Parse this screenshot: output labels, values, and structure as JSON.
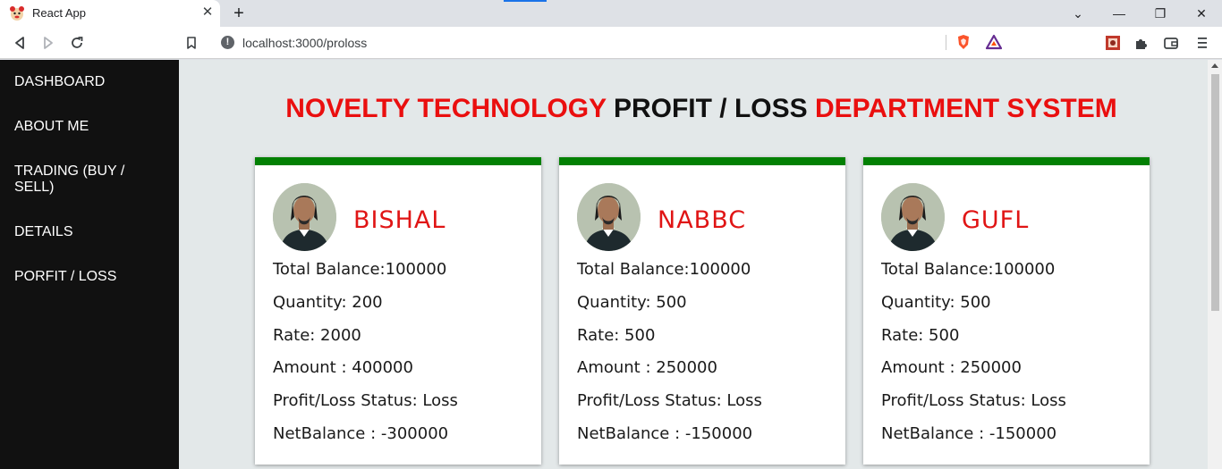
{
  "browser": {
    "tab_title": "React App",
    "tab_close": "✕",
    "new_tab": "+",
    "url": "localhost:3000/proloss",
    "window_controls": {
      "dropdown": "⌄",
      "minimize": "—",
      "restore": "❐",
      "close": "✕"
    },
    "icons": [
      "back-icon",
      "forward-icon",
      "reload-icon",
      "bookmark-icon",
      "site-info-icon",
      "brave-shields-icon",
      "brave-rewards-icon",
      "extension-icon",
      "puzzle-icon",
      "wallet-icon",
      "menu-icon"
    ]
  },
  "sidebar": {
    "items": [
      {
        "label": "DASHBOARD"
      },
      {
        "label": "ABOUT ME"
      },
      {
        "label": "TRADING (BUY / SELL)"
      },
      {
        "label": "DETAILS"
      },
      {
        "label": "PORFIT / LOSS"
      }
    ]
  },
  "heading": {
    "part1": "NOVELTY TECHNOLOGY",
    "part2": "PROFIT / LOSS",
    "part3": "DEPARTMENT SYSTEM"
  },
  "cards": [
    {
      "name": "BISHAL",
      "total_balance": "Total Balance:100000",
      "quantity": "Quantity: 200",
      "rate": "Rate: 2000",
      "amount": "Amount : 400000",
      "status": "Profit/Loss Status: Loss",
      "net_balance": "NetBalance : -300000"
    },
    {
      "name": "NABBC",
      "total_balance": "Total Balance:100000",
      "quantity": "Quantity: 500",
      "rate": "Rate: 500",
      "amount": "Amount : 250000",
      "status": "Profit/Loss Status: Loss",
      "net_balance": "NetBalance : -150000"
    },
    {
      "name": "GUFL",
      "total_balance": "Total Balance:100000",
      "quantity": "Quantity: 500",
      "rate": "Rate: 500",
      "amount": "Amount : 250000",
      "status": "Profit/Loss Status: Loss",
      "net_balance": "NetBalance : -150000"
    }
  ],
  "colors": {
    "accent_red": "#ea0f0f",
    "card_top": "#028003",
    "sidebar_bg": "#111111",
    "main_bg": "#e3e8e9"
  }
}
